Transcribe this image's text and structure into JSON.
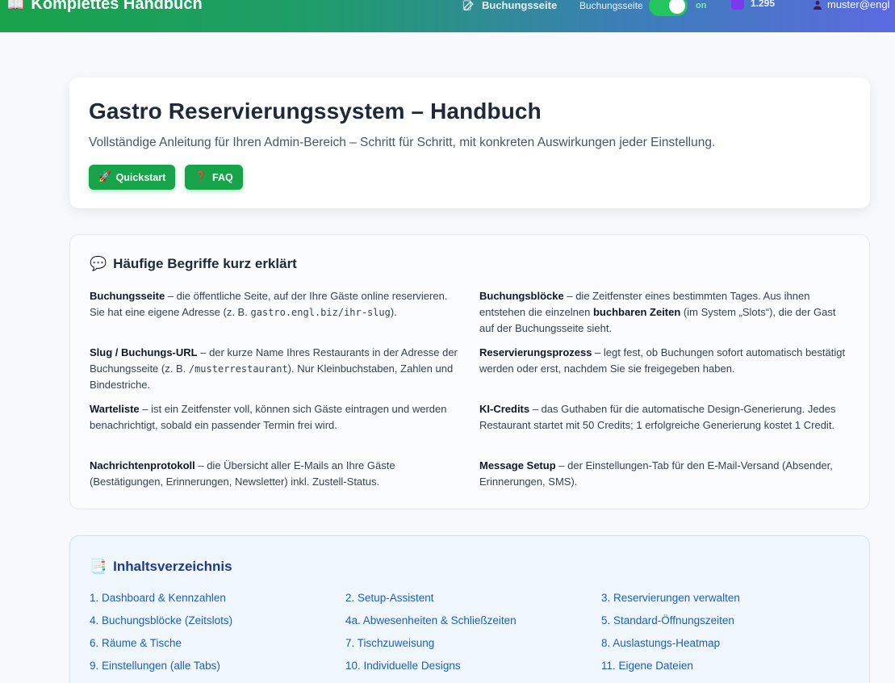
{
  "topbar": {
    "brand_icon": "📖",
    "brand": "Komplettes Handbuch",
    "booking_link": "Buchungsseite",
    "booking_small": "Buchungsseite",
    "toggle_state": "on",
    "toggle_label": "on",
    "credits": "1.295",
    "user": "muster@engl"
  },
  "hero": {
    "title": "Gastro Reservierungssystem – Handbuch",
    "subtitle": "Vollständige Anleitung für Ihren Admin-Bereich – Schritt für Schritt, mit konkreten Auswirkungen jeder Einstellung.",
    "quickstart_icon": "🚀",
    "quickstart": "Quickstart",
    "faq_icon": "❓",
    "faq": "FAQ"
  },
  "terms": {
    "icon": "💬",
    "title": "Häufige Begriffe kurz erklärt",
    "items": [
      {
        "term": "Buchungsseite",
        "pre": " – die öffentliche Seite, auf der Ihre Gäste online reservieren. Sie hat eine eigene Adresse (z. B. ",
        "code": "gastro.engl.biz/ihr-slug",
        "post": ")."
      },
      {
        "term": "Buchungsblöcke",
        "pre": " – die Zeitfenster eines bestimmten Tages. Aus ihnen entstehen die einzelnen ",
        "bold2": "buchbaren Zeiten",
        "post": " (im System „Slots“), die der Gast auf der Buchungsseite sieht."
      },
      {
        "term": "Slug / Buchungs-URL",
        "pre": " – der kurze Name Ihres Restaurants in der Adresse der Buchungsseite (z. B. ",
        "code": "/musterrestaurant",
        "post": "). Nur Kleinbuchstaben, Zahlen und Bindestriche."
      },
      {
        "term": "Reservierungsprozess",
        "pre": " – legt fest, ob Buchungen sofort automatisch bestätigt werden oder erst, nachdem Sie sie freigegeben haben.",
        "post": ""
      },
      {
        "term": "Warteliste",
        "pre": " – ist ein Zeitfenster voll, können sich Gäste eintragen und werden benachrichtigt, sobald ein passender Termin frei wird.",
        "post": ""
      },
      {
        "term": "KI-Credits",
        "pre": " – das Guthaben für die automatische Design-Generierung. Jedes Restaurant startet mit 50 Credits; 1 erfolgreiche Generierung kostet 1 Credit.",
        "post": ""
      },
      {
        "term": "Nachrichtenprotokoll",
        "pre": " – die Übersicht aller E-Mails an Ihre Gäste (Bestätigungen, Erinnerungen, Newsletter) inkl. Zustell-Status.",
        "post": ""
      },
      {
        "term": "Message Setup",
        "pre": " – der Einstellungen-Tab für den E-Mail-Versand (Absender, Erinnerungen, SMS).",
        "post": ""
      }
    ]
  },
  "toc": {
    "icon": "📑",
    "title": "Inhaltsverzeichnis",
    "items": [
      "1. Dashboard & Kennzahlen",
      "2. Setup-Assistent",
      "3. Reservierungen verwalten",
      "4. Buchungsblöcke (Zeitslots)",
      "4a. Abwesenheiten & Schließzeiten",
      "5. Standard-Öffnungszeiten",
      "6. Räume & Tische",
      "7. Tischzuweisung",
      "8. Auslastungs-Heatmap",
      "9. Einstellungen (alle Tabs)",
      "10. Individuelle Designs",
      "11. Eigene Dateien"
    ]
  }
}
